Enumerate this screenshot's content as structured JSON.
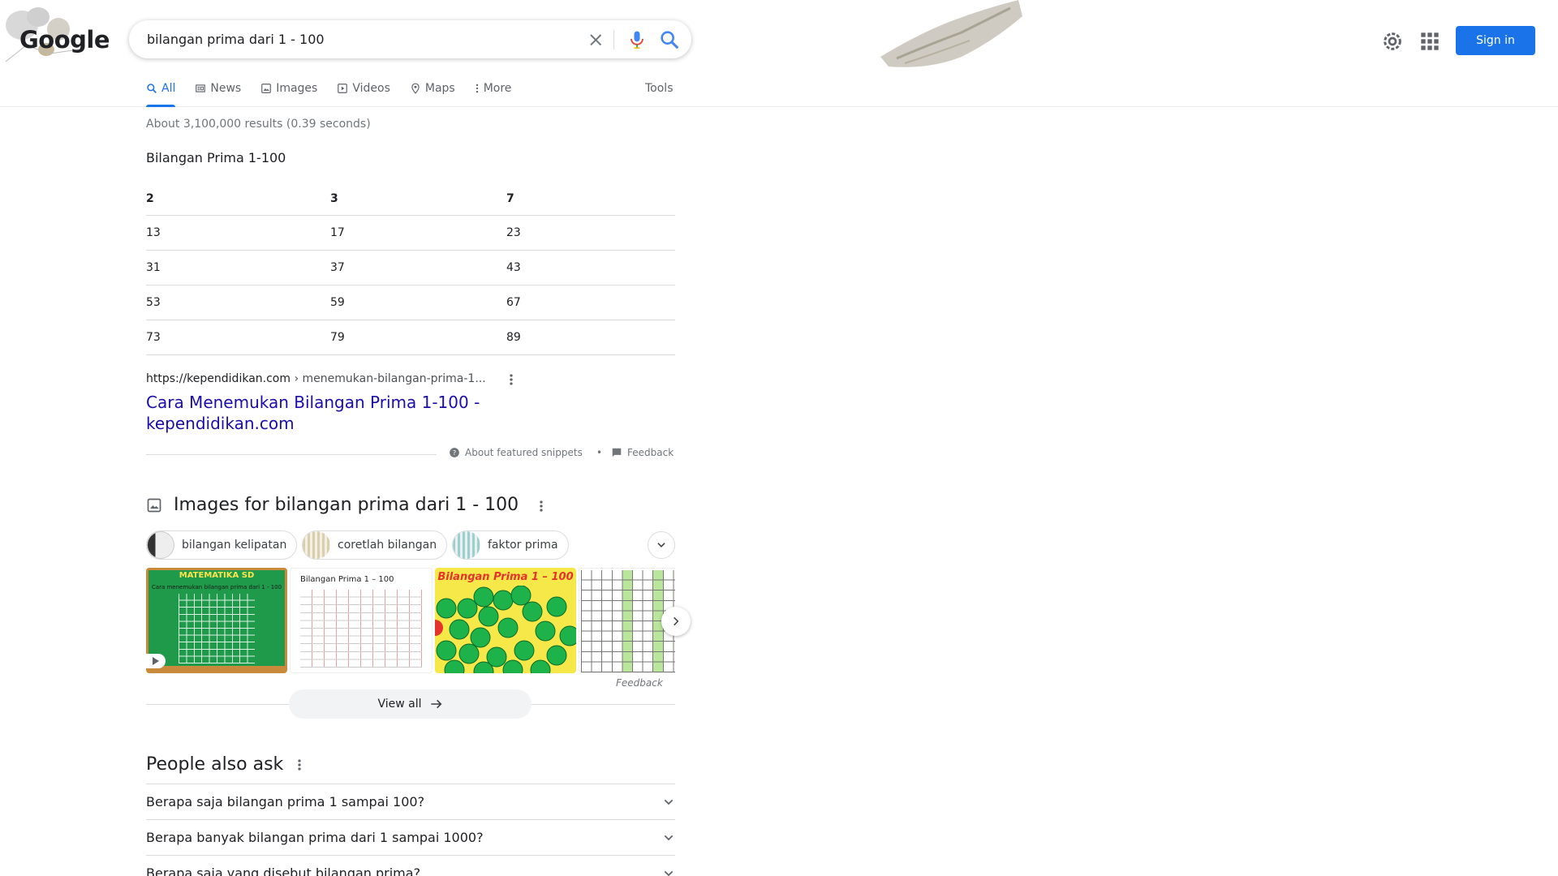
{
  "logo": {
    "text": "Google"
  },
  "search": {
    "query": "bilangan prima dari 1 - 100"
  },
  "header": {
    "signin_label": "Sign in"
  },
  "tabs": [
    {
      "label": "All",
      "icon": "search-icon",
      "active": true
    },
    {
      "label": "News",
      "icon": "news-icon"
    },
    {
      "label": "Images",
      "icon": "image-icon"
    },
    {
      "label": "Videos",
      "icon": "video-icon"
    },
    {
      "label": "Maps",
      "icon": "map-pin-icon"
    },
    {
      "label": "More",
      "icon": "more-vert-icon"
    }
  ],
  "tools_label": "Tools",
  "stats": "About 3,100,000 results (0.39 seconds)",
  "snippet": {
    "title": "Bilangan Prima 1-100",
    "header": [
      "2",
      "3",
      "7"
    ],
    "rows": [
      [
        "13",
        "17",
        "23"
      ],
      [
        "31",
        "37",
        "43"
      ],
      [
        "53",
        "59",
        "67"
      ],
      [
        "73",
        "79",
        "89"
      ]
    ],
    "cite_domain": "https://kependidikan.com",
    "cite_path": " › menemukan-bilangan-prima-1...",
    "link_text": "Cara Menemukan Bilangan Prima 1-100 - kependidikan.com",
    "about_label": "About featured snippets",
    "bullet": "•",
    "feedback_label": "Feedback"
  },
  "images": {
    "heading": "Images for bilangan prima dari 1 - 100",
    "chips": [
      "bilangan kelipatan",
      "coretlah bilangan",
      "faktor prima"
    ],
    "tiles": [
      {
        "title": "MATEMATIKA SD",
        "subtitle": "Cara menemukan bilangan prima dari 1 - 100"
      },
      {
        "title": "Bilangan Prima 1 – 100"
      },
      {
        "title": "Bilangan Prima 1 – 100",
        "numbers": [
          "2",
          "3",
          "5",
          "7",
          "11",
          "13",
          "17",
          "19",
          "23",
          "29",
          "31",
          "37",
          "41",
          "43",
          "47",
          "53",
          "59",
          "61",
          "67",
          "71",
          "73",
          "79",
          "83"
        ]
      },
      {
        "title": ""
      }
    ],
    "feedback_label": "Feedback",
    "view_all_label": "View all"
  },
  "paa": {
    "title": "People also ask",
    "questions": [
      "Berapa saja bilangan prima 1 sampai 100?",
      "Berapa banyak bilangan prima dari 1 sampai 1000?",
      "Berapa saja yang disebut bilangan prima?"
    ]
  },
  "colors": {
    "accent": "#1a73e8",
    "link": "#1a0dab",
    "chalkboard": "#1e9a4a"
  }
}
